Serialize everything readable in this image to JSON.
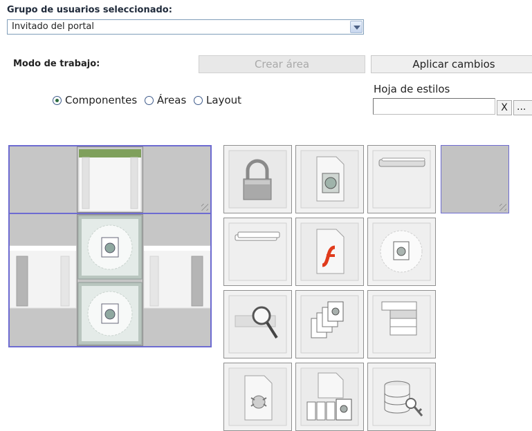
{
  "header": {
    "group_label": "Grupo de usuarios seleccionado:",
    "group_value": "Invitado del portal",
    "mode_label": "Modo de trabajo:",
    "create_area": "Crear área",
    "apply_changes": "Aplicar cambios"
  },
  "modes": {
    "components": "Componentes",
    "areas": "Áreas",
    "layout": "Layout",
    "selected": "Componentes"
  },
  "stylesheet": {
    "label": "Hoja de estilos",
    "value": "",
    "clear": "X",
    "browse": "..."
  },
  "components": [
    "lock-icon",
    "document-image-icon",
    "menu-bar-icon",
    "empty-component",
    "stacked-bars-icon",
    "flash-document-icon",
    "image-frame-icon",
    "search-box-icon",
    "image-stack-icon",
    "stacked-list-icon",
    "document-bug-icon",
    "image-gallery-icon",
    "database-key-icon"
  ]
}
